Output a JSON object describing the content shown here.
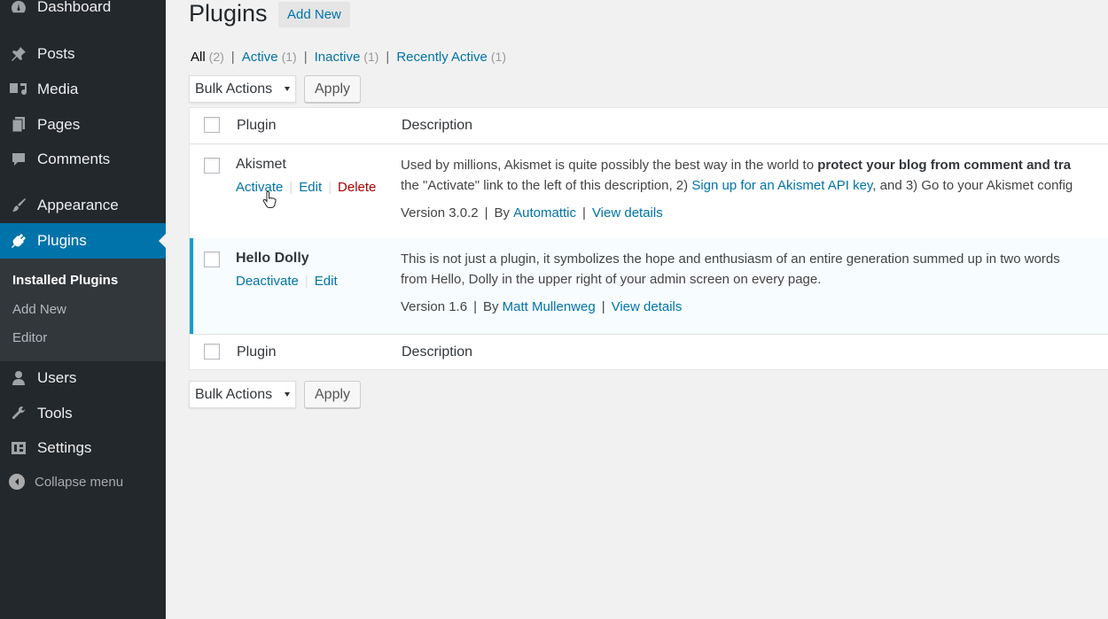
{
  "sidebar": {
    "items": [
      {
        "label": "Dashboard",
        "icon": "dashboard-icon"
      },
      {
        "label": "Posts",
        "icon": "pin-icon"
      },
      {
        "label": "Media",
        "icon": "media-icon"
      },
      {
        "label": "Pages",
        "icon": "pages-icon"
      },
      {
        "label": "Comments",
        "icon": "comments-icon"
      },
      {
        "label": "Appearance",
        "icon": "brush-icon"
      },
      {
        "label": "Plugins",
        "icon": "plug-icon"
      },
      {
        "label": "Users",
        "icon": "user-icon"
      },
      {
        "label": "Tools",
        "icon": "wrench-icon"
      },
      {
        "label": "Settings",
        "icon": "settings-icon"
      }
    ],
    "submenu": [
      "Installed Plugins",
      "Add New",
      "Editor"
    ],
    "collapse": "Collapse menu"
  },
  "header": {
    "title": "Plugins",
    "add_new": "Add New"
  },
  "filters": [
    {
      "label": "All",
      "count": "(2)"
    },
    {
      "label": "Active",
      "count": "(1)"
    },
    {
      "label": "Inactive",
      "count": "(1)"
    },
    {
      "label": "Recently Active",
      "count": "(1)"
    }
  ],
  "bulk": {
    "select_label": "Bulk Actions",
    "apply_label": "Apply"
  },
  "table": {
    "col_plugin": "Plugin",
    "col_description": "Description",
    "rows": [
      {
        "name": "Akismet",
        "actions": [
          "Activate",
          "Edit",
          "Delete"
        ],
        "desc_line1_a": "Used by millions, Akismet is quite possibly the best way in the world to ",
        "desc_line1_b": "protect your blog from comment and tra",
        "desc_line2_a": "the \"Activate\" link to the left of this description, 2) ",
        "desc_line2_link": "Sign up for an Akismet API key",
        "desc_line2_b": ", and 3) Go to your Akismet config",
        "version": "Version 3.0.2",
        "by": "By",
        "author": "Automattic",
        "details": "View details"
      },
      {
        "name": "Hello Dolly",
        "actions": [
          "Deactivate",
          "Edit"
        ],
        "desc_line1": "This is not just a plugin, it symbolizes the hope and enthusiasm of an entire generation summed up in two words",
        "desc_line2": "from Hello, Dolly in the upper right of your admin screen on every page.",
        "version": "Version 1.6",
        "by": "By",
        "author": "Matt Mullenweg",
        "details": "View details"
      }
    ]
  },
  "colors": {
    "sidebar_bg": "#23282d",
    "accent": "#0073aa",
    "active_border": "#00a0d2",
    "delete": "#a00"
  }
}
